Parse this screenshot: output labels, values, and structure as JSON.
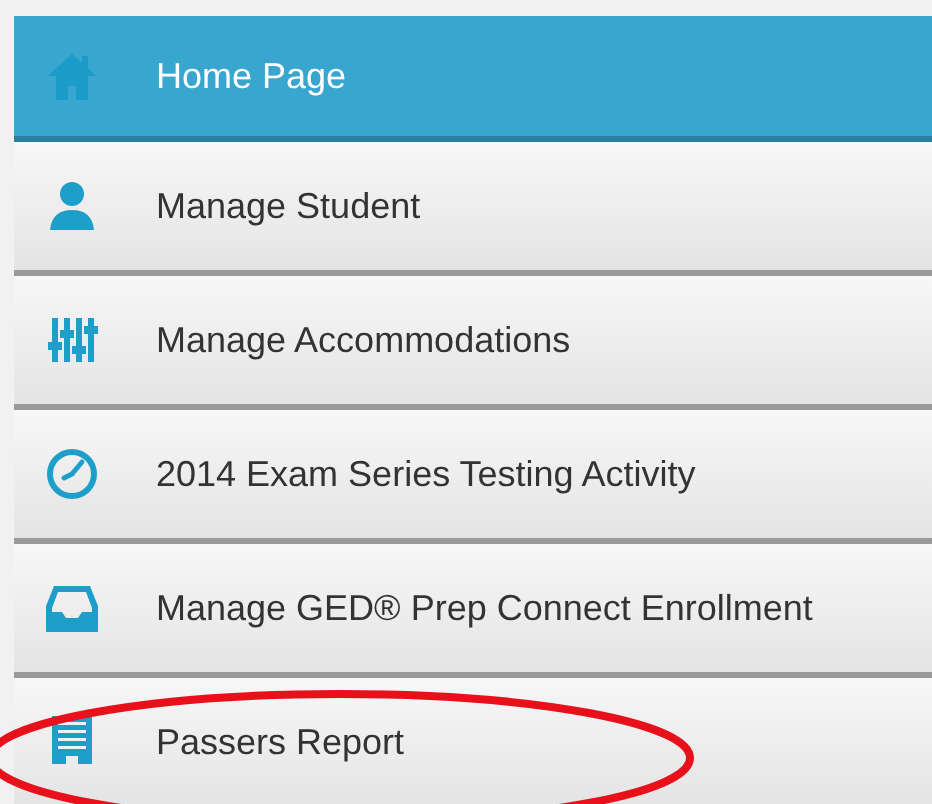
{
  "menu": {
    "items": [
      {
        "label": "Home Page",
        "kind": "home",
        "selected": true,
        "highlighted": false
      },
      {
        "label": "Manage Student",
        "kind": "user",
        "selected": false,
        "highlighted": false
      },
      {
        "label": "Manage Accommodations",
        "kind": "sliders",
        "selected": false,
        "highlighted": false
      },
      {
        "label": "2014 Exam Series Testing Activity",
        "kind": "clock",
        "selected": false,
        "highlighted": false
      },
      {
        "label": "Manage GED® Prep Connect Enrollment",
        "kind": "inbox",
        "selected": false,
        "highlighted": false
      },
      {
        "label": "Passers Report",
        "kind": "building",
        "selected": false,
        "highlighted": true
      }
    ]
  }
}
